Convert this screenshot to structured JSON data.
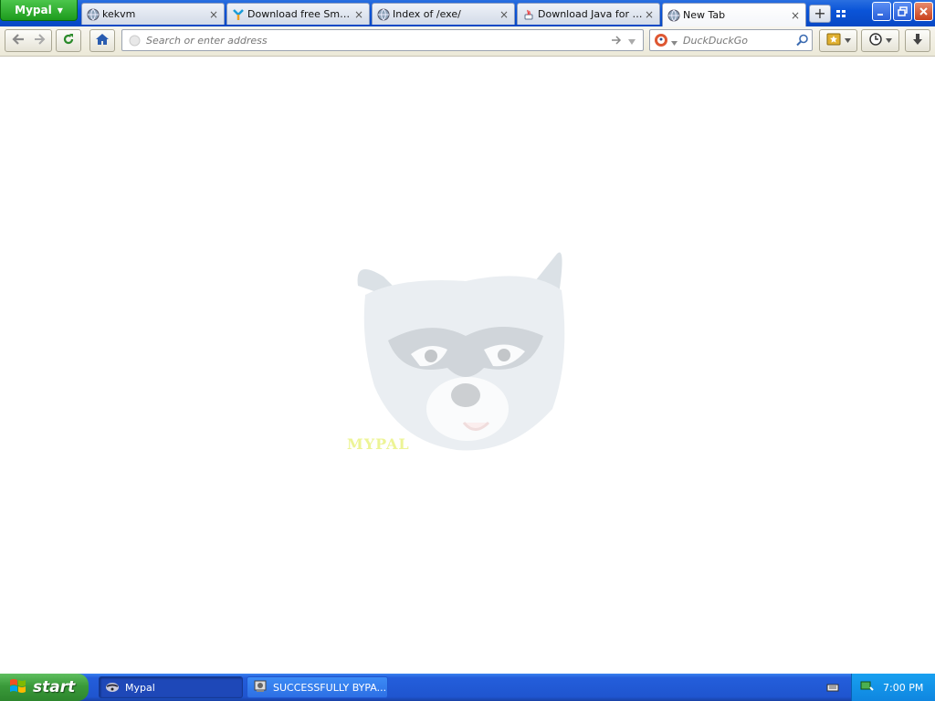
{
  "browser": {
    "app_button_label": "Mypal",
    "tabs": [
      {
        "label": "kekvm",
        "icon": "globe-icon"
      },
      {
        "label": "Download free Smart ...",
        "icon": "download-site-icon"
      },
      {
        "label": "Index of /exe/",
        "icon": "globe-icon"
      },
      {
        "label": "Download Java for Wi...",
        "icon": "java-icon"
      },
      {
        "label": "New Tab",
        "icon": "globe-icon"
      }
    ],
    "new_tab_symbol": "+",
    "close_symbol": "×"
  },
  "navbar": {
    "address_placeholder": "Search or enter address",
    "search_placeholder": "DuckDuckGo"
  },
  "page": {
    "logo_text": "MYPAL"
  },
  "taskbar": {
    "start_label": "start",
    "tasks": [
      {
        "label": "Mypal"
      },
      {
        "label": "SUCCESSFULLY BYPA..."
      }
    ],
    "clock": "7:00 PM"
  },
  "colors": {
    "title_blue": "#0a54d8",
    "start_green": "#3a9a3a",
    "taskbar_blue": "#245edb",
    "tray_blue": "#0f86e0"
  }
}
